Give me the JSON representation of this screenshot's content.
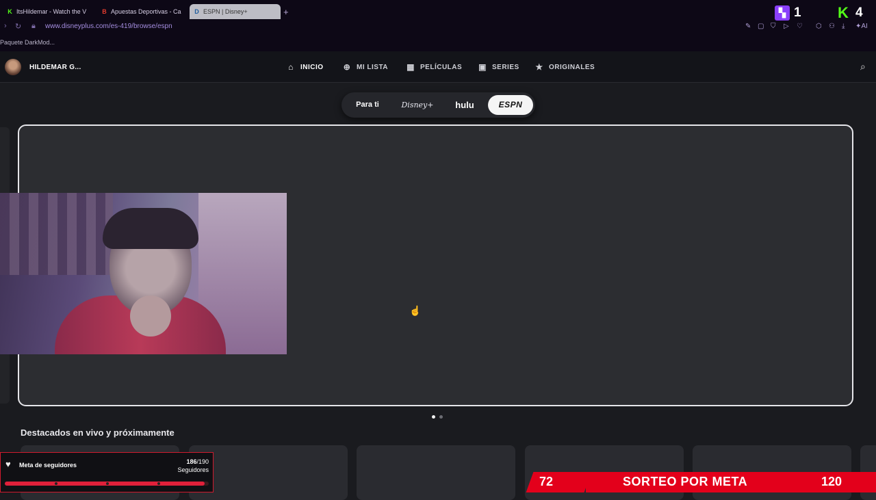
{
  "browser": {
    "tabs": [
      {
        "title": "ItsHildemar - Watch the V",
        "icon": "kick-icon",
        "color": "#53fc18"
      },
      {
        "title": "Apuestas Deportivas - Ca",
        "icon": "bookmaker-icon",
        "color": "#e23b2e"
      },
      {
        "title": "ESPN | Disney+",
        "icon": "disney-icon",
        "color": "#1e5c9e",
        "active": true
      }
    ],
    "url": "www.disneyplus.com/es-419/browse/espn",
    "bookmark": "Paquete DarkMod..."
  },
  "overlay": {
    "twitch_count": "1",
    "kick_count": "4",
    "goal": {
      "title": "Meta de seguidores",
      "current": "186",
      "target": "/190",
      "unit": "Seguidores",
      "progress": 0.979
    },
    "sorteo": {
      "left": "72",
      "label": "SORTEO POR META",
      "right": "120"
    }
  },
  "disney": {
    "user": "HILDEMAR G...",
    "nav": [
      {
        "label": "INICIO",
        "icon": "home-icon"
      },
      {
        "label": "MI LISTA",
        "icon": "plus-icon"
      },
      {
        "label": "PELÍCULAS",
        "icon": "film-icon"
      },
      {
        "label": "SERIES",
        "icon": "tv-icon"
      },
      {
        "label": "ORIGINALES",
        "icon": "star-icon"
      }
    ],
    "brands": [
      "Para ti",
      "Disney+",
      "hulu",
      "ESPN"
    ],
    "selected_brand": "ESPN",
    "section_title": "Destacados en vivo y próximamente",
    "carousel_page": 1,
    "carousel_total": 2
  }
}
